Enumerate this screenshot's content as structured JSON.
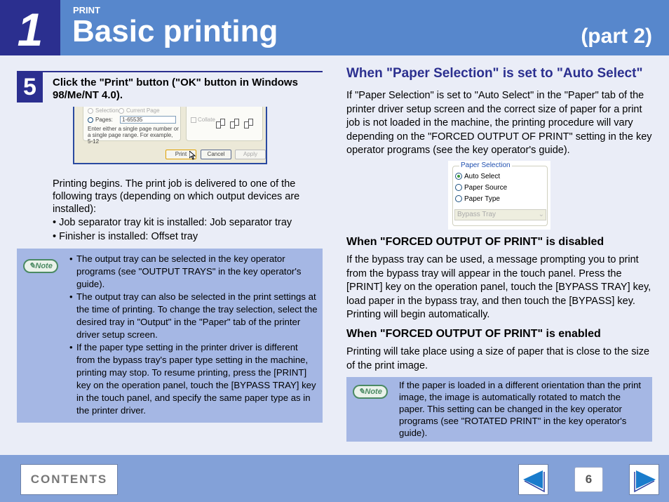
{
  "header": {
    "chapter_number": "1",
    "section_label": "PRINT",
    "title": "Basic printing",
    "part": "(part 2)"
  },
  "step": {
    "number": "5",
    "instruction": "Click the \"Print\" button (\"OK\" button in Windows 98/Me/NT 4.0)."
  },
  "print_dialog": {
    "radio_selection": "Selection",
    "radio_current_page": "Current Page",
    "radio_pages": "Pages:",
    "pages_value": "1-65535",
    "hint": "Enter either a single page number or a single page range.  For example, 5-12",
    "collate_label": "Collate",
    "collate_pages": [
      "1",
      "1",
      "2",
      "2",
      "3",
      "3"
    ],
    "print_button": "Print",
    "cancel_button": "Cancel",
    "apply_button": "Apply"
  },
  "left_body": {
    "paragraph": "Printing begins. The print job is delivered to one of the following trays (depending on which output devices are installed):",
    "bullets": [
      "Job separator tray kit is installed: Job separator tray",
      "Finisher is installed: Offset tray"
    ]
  },
  "left_note": {
    "badge": "Note",
    "items": [
      "The output tray can be selected in the key operator programs (see \"OUTPUT TRAYS\" in the key operator's guide).",
      "The output tray can also be selected in the print settings at the time of printing. To change the tray selection, select the desired tray in \"Output\" in the \"Paper\" tab of the printer driver setup screen.",
      "If the paper type setting in the printer driver is different from the bypass tray's paper type setting in the machine, printing may stop. To resume printing, press the [PRINT] key on the operation panel, touch the [BYPASS TRAY] key in the touch panel, and specify the same paper type as in the printer driver."
    ]
  },
  "right": {
    "title": "When \"Paper Selection\" is set to \"Auto Select\"",
    "intro": "If \"Paper Selection\" is set to \"Auto Select\" in the \"Paper\" tab of the printer driver setup screen and the correct size of paper for a print job is not loaded in the machine, the printing procedure will vary depending on the \"FORCED OUTPUT OF PRINT\" setting in the key operator programs (see the key operator's guide).",
    "paper_selection": {
      "legend": "Paper Selection",
      "options": [
        "Auto Select",
        "Paper Source",
        "Paper Type"
      ],
      "selected": "Auto Select",
      "dropdown_value": "Bypass Tray"
    },
    "disabled_heading": "When \"FORCED OUTPUT OF PRINT\" is disabled",
    "disabled_text": "If the bypass tray can be used, a message prompting you to print from the bypass tray will appear in the touch panel. Press the [PRINT] key on the operation panel, touch the [BYPASS TRAY] key, load paper in the bypass tray, and then touch the [BYPASS] key. Printing will begin automatically.",
    "enabled_heading": "When \"FORCED OUTPUT OF PRINT\" is enabled",
    "enabled_text": "Printing will take place using a size of paper that is close to the size of the print image.",
    "note_badge": "Note",
    "note_text": "If the paper is loaded in a different orientation than the print image, the image is automatically rotated to match the paper. This setting can be changed in the key operator programs (see \"ROTATED PRINT\" in the key operator's guide)."
  },
  "footer": {
    "contents_label": "CONTENTS",
    "page_number": "6",
    "prev_icon": "left-arrow-icon",
    "next_icon": "right-arrow-icon"
  },
  "colors": {
    "header_blue": "#5787cc",
    "chapter_navy": "#2b2f8f",
    "note_bg": "#a5b7e4",
    "page_bg": "#eaedf7",
    "footer_blue": "#83a1d8",
    "arrow_blue": "#1a7ccc"
  }
}
